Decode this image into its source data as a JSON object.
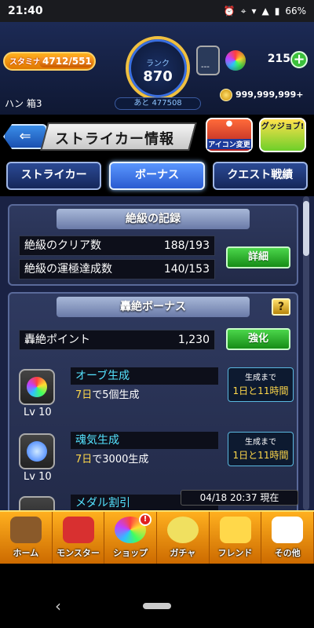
{
  "statusbar": {
    "time": "21:40",
    "battery": "66%"
  },
  "header": {
    "stamina_label": "スタミナ",
    "stamina_value": "4712/551",
    "stamina_fill": 1.0,
    "rank_label": "ランク",
    "rank_value": "870",
    "rank_next": "あと 477508",
    "orbs": "215",
    "coins": "999,999,999+",
    "username": "ハン 箱3",
    "lock_label": "---"
  },
  "title": {
    "text": "ストライカー情報",
    "icon_btn_a": "アイコン変更",
    "icon_btn_b": "グッジョブ!"
  },
  "tabs": [
    {
      "label": "ストライカー"
    },
    {
      "label": "ボーナス"
    },
    {
      "label": "クエスト戦績"
    }
  ],
  "records": {
    "title": "絶級の記録",
    "rows": [
      {
        "label": "絶級のクリア数",
        "value": "188/193"
      },
      {
        "label": "絶級の運極達成数",
        "value": "140/153"
      }
    ],
    "detail_button": "詳細"
  },
  "bonus": {
    "title": "轟絶ボーナス",
    "help": "?",
    "points_label": "轟絶ポイント",
    "points_value": "1,230",
    "upgrade_button": "強化",
    "items": [
      {
        "name": "オーブ生成",
        "desc_hl": "7日",
        "desc": "で5個生成",
        "level": "Lv 10",
        "time_label": "生成まで",
        "time": "1日と11時間"
      },
      {
        "name": "魂気生成",
        "desc_hl": "7日",
        "desc": "で3000生成",
        "level": "Lv 10",
        "time_label": "生成まで",
        "time": "1日と11時間"
      },
      {
        "name": "メダル割引"
      }
    ]
  },
  "datestamp": "04/18 20:37 現在",
  "nav": [
    {
      "label": "ホーム"
    },
    {
      "label": "モンスター"
    },
    {
      "label": "ショップ"
    },
    {
      "label": "ガチャ"
    },
    {
      "label": "フレンド"
    },
    {
      "label": "その他"
    }
  ],
  "shop_badge": "!"
}
